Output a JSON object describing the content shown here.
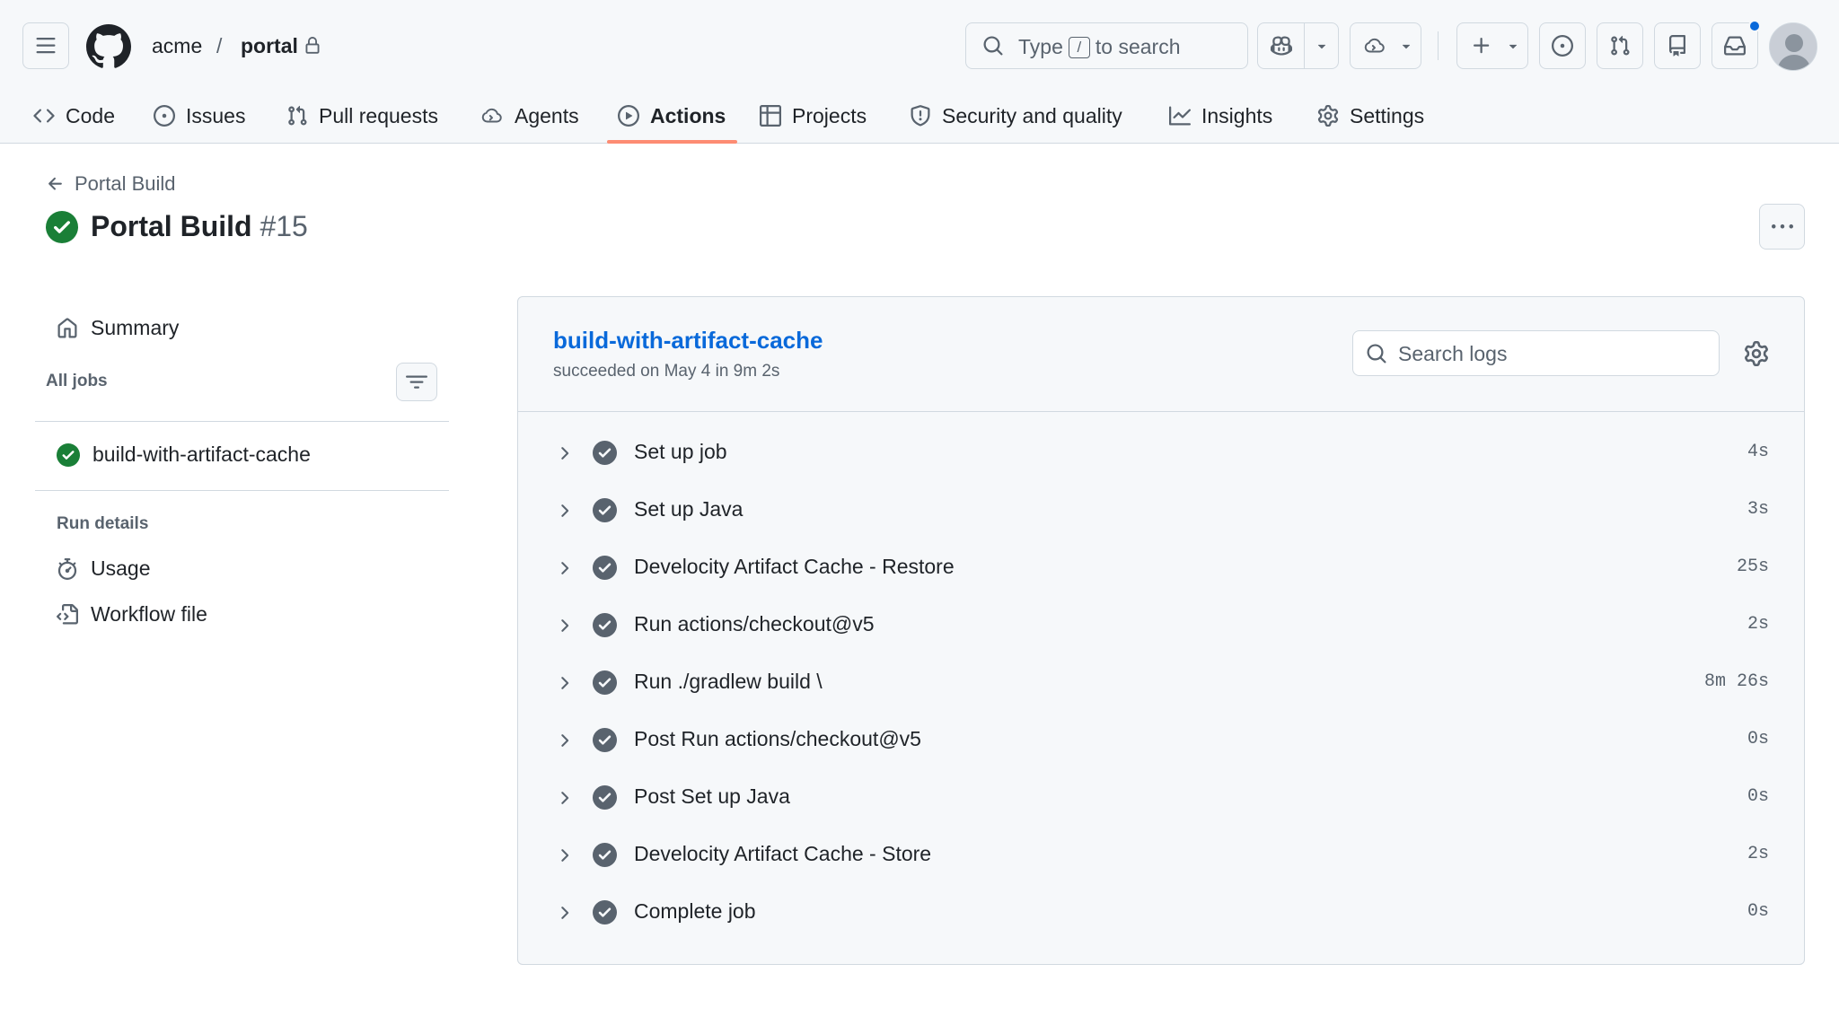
{
  "header": {
    "owner": "acme",
    "separator": "/",
    "repo": "portal",
    "search": {
      "prefix": "Type",
      "key": "/",
      "suffix": "to search"
    }
  },
  "tabs": [
    {
      "label": "Code",
      "icon": "code-icon"
    },
    {
      "label": "Issues",
      "icon": "issue-opened-icon"
    },
    {
      "label": "Pull requests",
      "icon": "git-pull-request-icon"
    },
    {
      "label": "Agents",
      "icon": "agent-icon"
    },
    {
      "label": "Actions",
      "icon": "play-icon",
      "active": true
    },
    {
      "label": "Projects",
      "icon": "table-icon"
    },
    {
      "label": "Security and quality",
      "icon": "shield-icon"
    },
    {
      "label": "Insights",
      "icon": "graph-icon"
    },
    {
      "label": "Settings",
      "icon": "gear-icon"
    }
  ],
  "run": {
    "back_label": "Portal Build",
    "title": "Portal Build",
    "number": "#15",
    "status": "success"
  },
  "sidebar": {
    "summary_label": "Summary",
    "all_jobs_heading": "All jobs",
    "jobs": [
      {
        "label": "build-with-artifact-cache",
        "status": "success"
      }
    ],
    "run_details_heading": "Run details",
    "usage_label": "Usage",
    "workflow_file_label": "Workflow file"
  },
  "job": {
    "title": "build-with-artifact-cache",
    "subtitle": "succeeded on May 4 in 9m 2s",
    "search_placeholder": "Search logs",
    "steps": [
      {
        "name": "Set up job",
        "duration": "4s"
      },
      {
        "name": "Set up Java",
        "duration": "3s"
      },
      {
        "name": "Develocity Artifact Cache - Restore",
        "duration": "25s"
      },
      {
        "name": "Run actions/checkout@v5",
        "duration": "2s"
      },
      {
        "name": "Run ./gradlew build \\",
        "duration": "8m 26s"
      },
      {
        "name": "Post Run actions/checkout@v5",
        "duration": "0s"
      },
      {
        "name": "Post Set up Java",
        "duration": "0s"
      },
      {
        "name": "Develocity Artifact Cache - Store",
        "duration": "2s"
      },
      {
        "name": "Complete job",
        "duration": "0s"
      }
    ]
  },
  "colors": {
    "accent": "#0969da",
    "success": "#1a7f37",
    "step_check": "#59636e",
    "tab_underline": "#fd8c73"
  }
}
